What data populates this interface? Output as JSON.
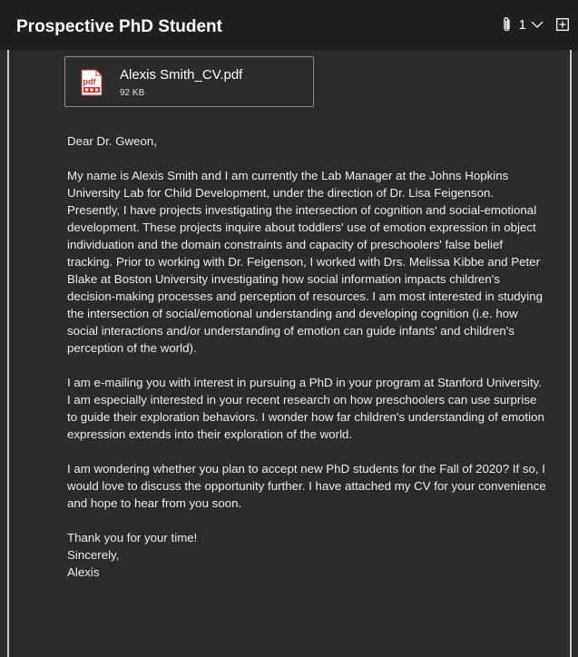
{
  "header": {
    "subject": "Prospective PhD Student",
    "attachment_count": "1"
  },
  "attachment": {
    "filename": "Alexis Smith_CV.pdf",
    "size": "92 KB",
    "type_label": "pdf"
  },
  "message": {
    "greeting": "Dear Dr. Gweon,",
    "paragraph1": "My name is Alexis Smith and I am currently the Lab Manager at the Johns Hopkins University Lab for Child Development, under the direction of Dr. Lisa Feigenson. Presently, I have projects investigating the intersection of cognition and social-emotional development. These projects inquire about toddlers' use of emotion expression in object individuation and the domain constraints and capacity of preschoolers' false belief tracking. Prior to working with Dr. Feigenson, I worked with Drs. Melissa Kibbe and Peter Blake at Boston University investigating how social information impacts children's decision-making processes and perception of resources. I am most interested in studying the intersection of social/emotional understanding and developing cognition (i.e. how social interactions and/or understanding of emotion can guide infants' and children's perception of the world).",
    "paragraph2": "I am e-mailing you with interest in pursuing a PhD in your program at Stanford University. I am especially interested in your recent research on how preschoolers can use surprise to guide their exploration behaviors. I wonder how far children's understanding of emotion expression extends into their exploration of the world.",
    "paragraph3": "I am wondering whether you plan to accept new PhD students for the Fall of 2020? If so, I would love to discuss the opportunity further. I have attached my CV for your convenience and hope to hear from you soon.",
    "closing1": "Thank you for your time!",
    "closing2": "Sincerely,",
    "signature": "Alexis"
  },
  "colors": {
    "header_bg": "#1f1f1f",
    "body_bg": "#2b2b2b",
    "pdf_red": "#d8322c"
  }
}
